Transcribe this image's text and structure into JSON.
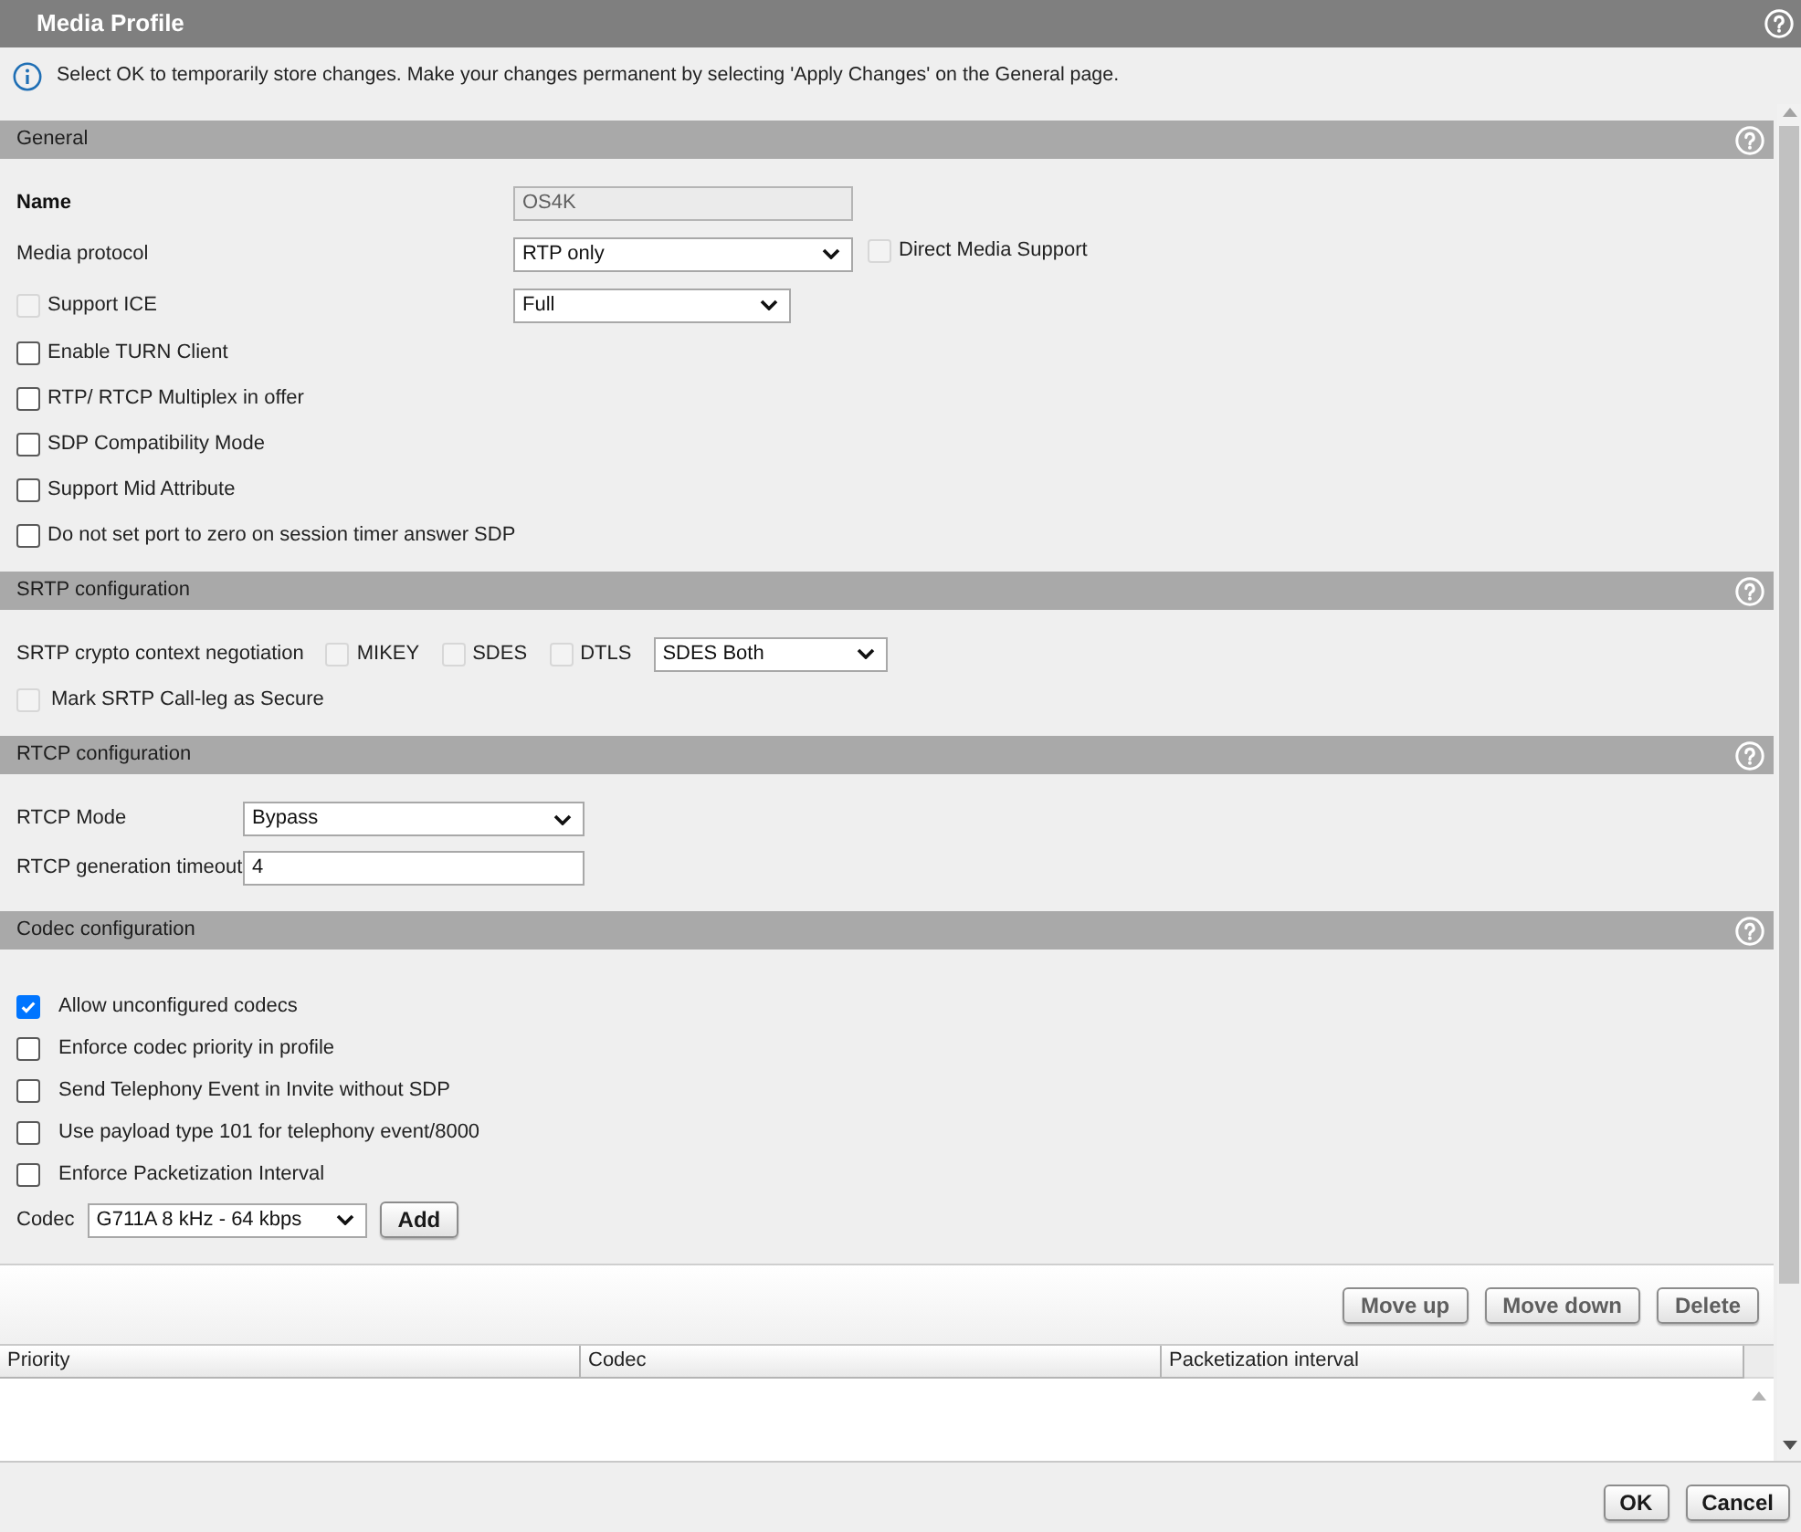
{
  "window": {
    "title": "Media Profile"
  },
  "info": "Select OK to temporarily store changes. Make your changes permanent by selecting 'Apply Changes' on the General page.",
  "sections": [
    {
      "title": "General",
      "rows": [
        {
          "kind": "input",
          "label": "Name",
          "bold": true,
          "value": "OS4K",
          "disabled": true
        },
        {
          "kind": "select",
          "label": "Media protocol",
          "value": "RTP only",
          "checkbox": {
            "label": "Direct Media Support",
            "checked": false,
            "disabled": true
          }
        },
        {
          "kind": "check_select",
          "label": "Support ICE",
          "checked": false,
          "disabled": true,
          "value": "Full"
        },
        {
          "kind": "checkbox",
          "label": "Enable TURN Client",
          "checked": false,
          "disabled": false
        },
        {
          "kind": "checkbox",
          "label": "RTP/ RTCP Multiplex in offer",
          "checked": false,
          "disabled": false
        },
        {
          "kind": "checkbox",
          "label": "SDP Compatibility Mode",
          "checked": false,
          "disabled": false
        },
        {
          "kind": "checkbox",
          "label": "Support Mid Attribute",
          "checked": false,
          "disabled": false
        },
        {
          "kind": "checkbox",
          "label": "Do not set port to zero on session timer answer SDP",
          "checked": false,
          "disabled": false
        }
      ]
    },
    {
      "title": "SRTP configuration",
      "rows": [
        {
          "kind": "check_group",
          "label": "SRTP crypto context negotiation",
          "options": [
            {
              "label": "MIKEY",
              "checked": false,
              "disabled": true
            },
            {
              "label": "SDES",
              "checked": false,
              "disabled": true
            },
            {
              "label": "DTLS",
              "checked": false,
              "disabled": true
            }
          ],
          "value": "SDES Both"
        },
        {
          "kind": "checkbox",
          "label": "Mark SRTP Call-leg as Secure",
          "checked": false,
          "disabled": true
        }
      ]
    },
    {
      "title": "RTCP configuration",
      "rows": [
        {
          "kind": "select",
          "label": "RTCP Mode",
          "value": "Bypass"
        },
        {
          "kind": "input",
          "label": "RTCP generation timeout",
          "value": "4",
          "disabled": false
        }
      ]
    },
    {
      "title": "Codec configuration",
      "rows": [
        {
          "kind": "checkbox",
          "label": "Allow unconfigured codecs",
          "checked": true,
          "disabled": false
        },
        {
          "kind": "checkbox",
          "label": "Enforce codec priority in profile",
          "checked": false,
          "disabled": false
        },
        {
          "kind": "checkbox",
          "label": "Send Telephony Event in Invite without SDP",
          "checked": false,
          "disabled": false
        },
        {
          "kind": "checkbox",
          "label": "Use payload type 101 for telephony event/8000",
          "checked": false,
          "disabled": false
        },
        {
          "kind": "checkbox",
          "label": "Enforce Packetization Interval",
          "checked": false,
          "disabled": false
        },
        {
          "kind": "select_button",
          "label": "Codec",
          "value": "G711A 8 kHz - 64 kbps",
          "button": {
            "label": "Add",
            "disabled": false
          }
        }
      ]
    }
  ],
  "codec_toolbar": {
    "buttons": [
      {
        "label": "Move up",
        "disabled": true
      },
      {
        "label": "Move down",
        "disabled": true
      },
      {
        "label": "Delete",
        "disabled": true
      }
    ]
  },
  "codec_table": {
    "columns": [
      "Priority",
      "Codec",
      "Packetization interval"
    ]
  },
  "footer": {
    "buttons": [
      {
        "label": "OK",
        "disabled": false
      },
      {
        "label": "Cancel",
        "disabled": false
      }
    ]
  }
}
